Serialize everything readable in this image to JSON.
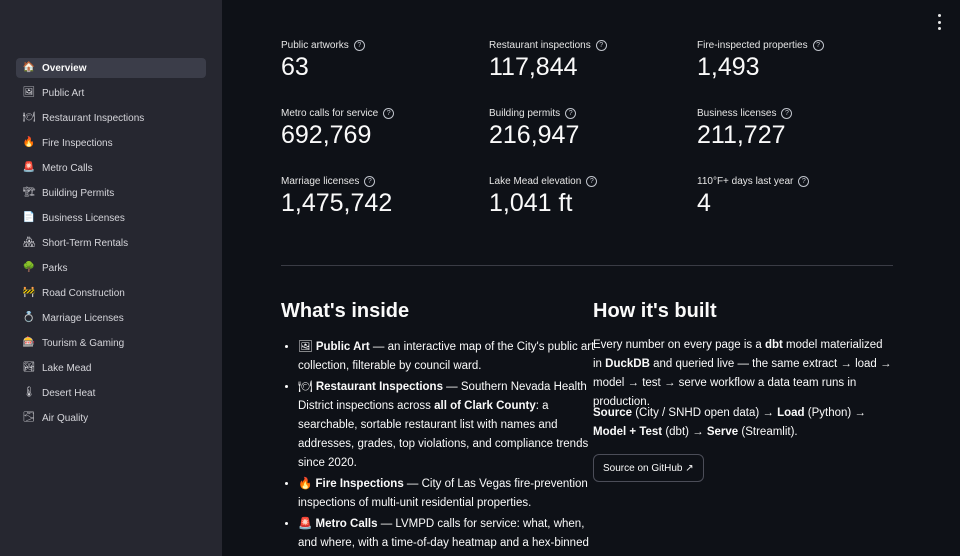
{
  "sidebar": {
    "items": [
      {
        "label": "Overview",
        "icon": "🏠"
      },
      {
        "label": "Public Art",
        "icon": "🖼"
      },
      {
        "label": "Restaurant Inspections",
        "icon": "🍽"
      },
      {
        "label": "Fire Inspections",
        "icon": "🔥"
      },
      {
        "label": "Metro Calls",
        "icon": "🚨"
      },
      {
        "label": "Building Permits",
        "icon": "🏗"
      },
      {
        "label": "Business Licenses",
        "icon": "📄"
      },
      {
        "label": "Short-Term Rentals",
        "icon": "🏘"
      },
      {
        "label": "Parks",
        "icon": "🌳"
      },
      {
        "label": "Road Construction",
        "icon": "🚧"
      },
      {
        "label": "Marriage Licenses",
        "icon": "💍"
      },
      {
        "label": "Tourism & Gaming",
        "icon": "🎰"
      },
      {
        "label": "Lake Mead",
        "icon": "🏞"
      },
      {
        "label": "Desert Heat",
        "icon": "🌡"
      },
      {
        "label": "Air Quality",
        "icon": "🌫"
      }
    ]
  },
  "metrics": [
    {
      "label": "Public artworks",
      "value": "63"
    },
    {
      "label": "Restaurant inspections",
      "value": "117,844"
    },
    {
      "label": "Fire-inspected properties",
      "value": "1,493"
    },
    {
      "label": "Metro calls for service",
      "value": "692,769"
    },
    {
      "label": "Building permits",
      "value": "216,947"
    },
    {
      "label": "Business licenses",
      "value": "211,727"
    },
    {
      "label": "Marriage licenses",
      "value": "1,475,742"
    },
    {
      "label": "Lake Mead elevation",
      "value": "1,041 ft"
    },
    {
      "label": "110°F+ days last year",
      "value": "4"
    }
  ],
  "inside": {
    "title": "What's inside",
    "items": [
      {
        "icon": "🖼",
        "name": "Public Art",
        "text": " — an interactive map of the City's public art collection, filterable by council ward."
      },
      {
        "icon": "🍽",
        "name": "Restaurant Inspections",
        "text_pre": " — Southern Nevada Health District inspections across ",
        "bold": "all of Clark County",
        "text_post": ": a searchable, sortable restaurant list with names and addresses, grades, top violations, and compliance trends since 2020."
      },
      {
        "icon": "🔥",
        "name": "Fire Inspections",
        "text": " — City of Las Vegas fire-prevention inspections of multi-unit residential properties."
      },
      {
        "icon": "🚨",
        "name": "Metro Calls",
        "text": " — LVMPD calls for service: what, when, and where, with a time-of-day heatmap and a hex-binned"
      }
    ]
  },
  "built": {
    "title": "How it's built",
    "p1_a": "Every number on every page is a ",
    "p1_b": "dbt",
    "p1_c": " model materialized in ",
    "p1_d": "DuckDB",
    "p1_e": " and queried live — the same extract → load → model → test → serve workflow a data team runs in production.",
    "p2_a": "Source",
    "p2_b": " (City / SNHD open data) → ",
    "p2_c": "Load",
    "p2_d": " (Python) → ",
    "p2_e": "Model + Test",
    "p2_f": " (dbt) → ",
    "p2_g": "Serve",
    "p2_h": " (Streamlit).",
    "button": "Source on GitHub ↗"
  },
  "help_glyph": "?"
}
